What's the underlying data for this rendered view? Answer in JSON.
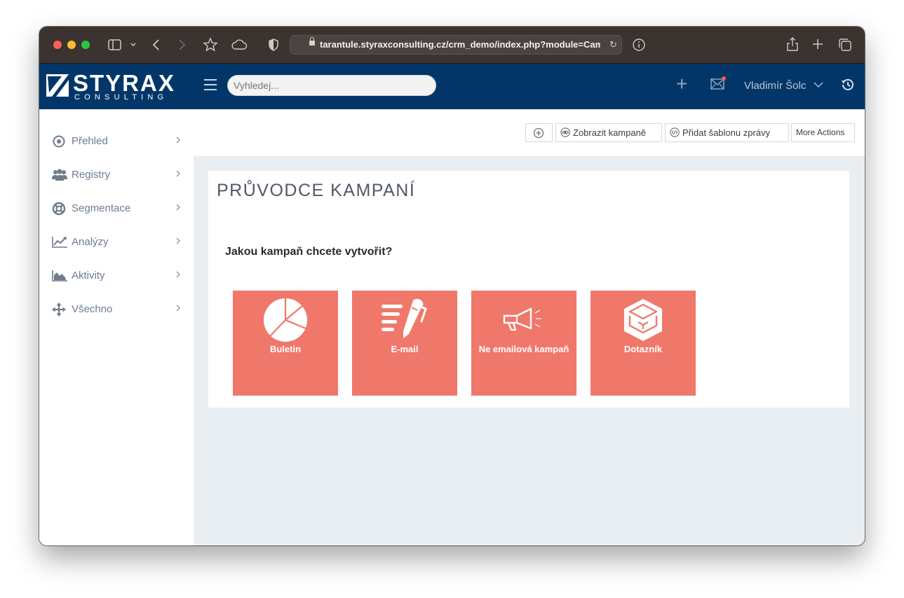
{
  "browser": {
    "url": "tarantule.styraxconsulting.cz/crm_demo/index.php?module=Camp"
  },
  "header": {
    "logo_word": "STYRAX",
    "logo_sub": "CONSULTING",
    "search_placeholder": "Vyhledej...",
    "user_name": "Vladimír Šolc",
    "brand_color": "#033668"
  },
  "sidebar": {
    "items": [
      {
        "label": "Přehled",
        "icon": "target-icon"
      },
      {
        "label": "Registry",
        "icon": "users-icon"
      },
      {
        "label": "Segmentace",
        "icon": "lifebuoy-icon"
      },
      {
        "label": "Analýzy",
        "icon": "line-chart-icon"
      },
      {
        "label": "Aktivity",
        "icon": "area-chart-icon"
      },
      {
        "label": "Všechno",
        "icon": "move-arrows-icon"
      }
    ]
  },
  "toolbar": {
    "show_campaigns": "Zobrazit kampaně",
    "add_template": "Přidat šablonu zprávy",
    "more_actions": "More Actions"
  },
  "main": {
    "title": "PRŮVODCE KAMPANÍ",
    "question": "Jakou kampaň chcete vytvořit?",
    "tile_color": "#ef786b",
    "tiles": [
      {
        "label": "Buletin",
        "icon": "pie-chart-icon"
      },
      {
        "label": "E-mail",
        "icon": "pen-lines-icon"
      },
      {
        "label": "Ne emailová kampaň",
        "icon": "megaphone-icon"
      },
      {
        "label": "Dotazník",
        "icon": "box-icon"
      }
    ]
  }
}
